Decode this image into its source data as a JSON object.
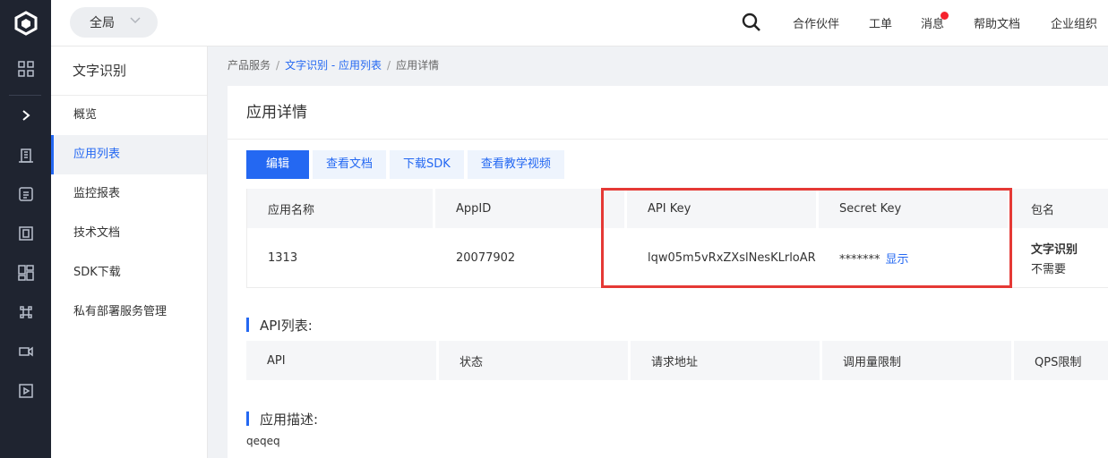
{
  "topbar": {
    "scope_label": "全局",
    "links": [
      "合作伙伴",
      "工单",
      "消息",
      "帮助文档",
      "企业组织"
    ]
  },
  "subnav": {
    "title": "文字识别",
    "items": [
      "概览",
      "应用列表",
      "监控报表",
      "技术文档",
      "SDK下载",
      "私有部署服务管理"
    ],
    "active_index": 1
  },
  "breadcrumb": {
    "root": "产品服务",
    "sep": "/",
    "link": "文字识别 - 应用列表",
    "current": "应用详情"
  },
  "page": {
    "title": "应用详情",
    "buttons": [
      "编辑",
      "查看文档",
      "下载SDK",
      "查看教学视频"
    ]
  },
  "app_table": {
    "columns": [
      "应用名称",
      "AppID",
      "API Key",
      "Secret Key",
      "包名"
    ],
    "row": {
      "name": "1313",
      "app_id": "20077902",
      "api_key": "lqw05m5vRxZXslNesKLrloAR",
      "secret_masked": "*******",
      "secret_show": "显示",
      "package_bold": "文字识别",
      "package_value": "不需要"
    }
  },
  "api_section": {
    "title": "API列表:",
    "columns": [
      "API",
      "状态",
      "请求地址",
      "调用量限制",
      "QPS限制"
    ]
  },
  "desc_section": {
    "title": "应用描述:",
    "text": "qeqeq"
  },
  "colors": {
    "accent": "#2468f2",
    "highlight": "#e53935",
    "rail": "#1f2430"
  }
}
